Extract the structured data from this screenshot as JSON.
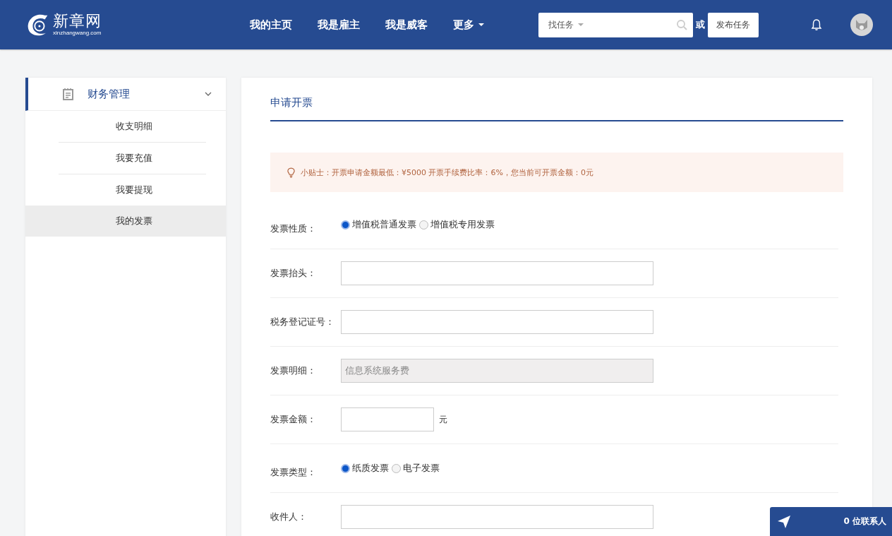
{
  "header": {
    "logo": {
      "name": "新章网",
      "domain": "xinzhangwang.com"
    },
    "nav": [
      {
        "label": "我的主页",
        "dropdown": false
      },
      {
        "label": "我是雇主",
        "dropdown": false
      },
      {
        "label": "我是威客",
        "dropdown": false
      },
      {
        "label": "更多",
        "dropdown": true
      }
    ],
    "search": {
      "category": "找任务"
    },
    "or_text": "或",
    "post_button": "发布任务"
  },
  "sidebar": {
    "group": {
      "title": "财务管理",
      "expanded": true,
      "items": [
        {
          "label": "收支明细",
          "selected": false
        },
        {
          "label": "我要充值",
          "selected": false
        },
        {
          "label": "我要提现",
          "selected": false
        },
        {
          "label": "我的发票",
          "selected": true
        }
      ]
    }
  },
  "main": {
    "title": "申请开票",
    "tip": "小贴士：开票申请金额最低：¥5000 开票手续费比率：6%，您当前可开票金额：0元",
    "rows": [
      {
        "kind": "radio",
        "label": "发票性质：",
        "options": [
          {
            "label": "增值税普通发票",
            "selected": true
          },
          {
            "label": "增值税专用发票",
            "selected": false
          }
        ]
      },
      {
        "kind": "input",
        "label": "发票抬头："
      },
      {
        "kind": "input",
        "label": "税务登记证号："
      },
      {
        "kind": "readonly",
        "label": "发票明细：",
        "value": "信息系统服务费"
      },
      {
        "kind": "amount",
        "label": "发票金额：",
        "unit": "元"
      },
      {
        "kind": "radio",
        "label": "发票类型：",
        "options": [
          {
            "label": "纸质发票",
            "selected": true
          },
          {
            "label": "电子发票",
            "selected": false
          }
        ]
      },
      {
        "kind": "input",
        "label": "收件人："
      }
    ]
  },
  "chat": {
    "contacts": "0 位联系人"
  }
}
